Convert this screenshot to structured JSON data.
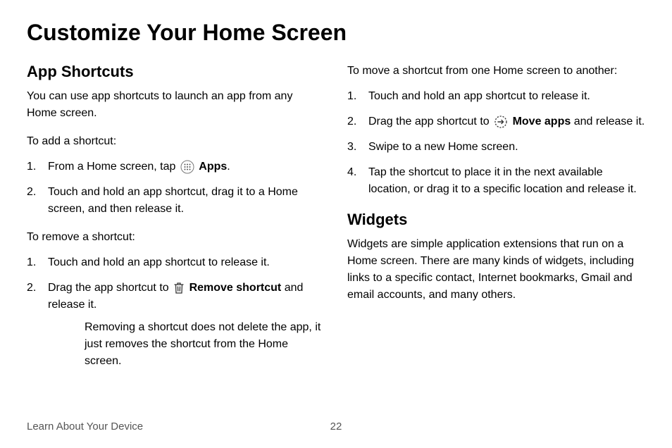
{
  "title": "Customize Your Home Screen",
  "leftCol": {
    "h2": "App Shortcuts",
    "intro": "You can use app shortcuts to launch an app from any Home screen.",
    "addLead": "To add a shortcut:",
    "addStep1_pre": "From a Home screen, tap ",
    "addStep1_bold": "Apps",
    "addStep1_post": ".",
    "addStep2": "Touch and hold an app shortcut, drag it to a Home screen, and then release it.",
    "removeLead": "To remove a shortcut:",
    "removeStep1": "Touch and hold an app shortcut to release it.",
    "removeStep2_pre": "Drag the app shortcut to ",
    "removeStep2_bold": "Remove shortcut",
    "removeStep2_post": " and release it.",
    "removeNote": "Removing a shortcut does not delete the app, it just removes the shortcut from the Home screen."
  },
  "rightCol": {
    "moveLead": "To move a shortcut from one Home screen to another:",
    "moveStep1": "Touch and hold an app shortcut to release it.",
    "moveStep2_pre": "Drag the app shortcut to ",
    "moveStep2_bold": "Move apps",
    "moveStep2_post": " and release it.",
    "moveStep3": "Swipe to a new Home screen.",
    "moveStep4": "Tap the shortcut to place it in the next available location, or drag it to a specific location and release it.",
    "widgetsH2": "Widgets",
    "widgetsBody": "Widgets are simple application extensions that run on a Home screen. There are many kinds of widgets, including links to a specific contact, Internet bookmarks, Gmail and email accounts, and many others."
  },
  "footer": {
    "section": "Learn About Your Device",
    "page": "22"
  }
}
